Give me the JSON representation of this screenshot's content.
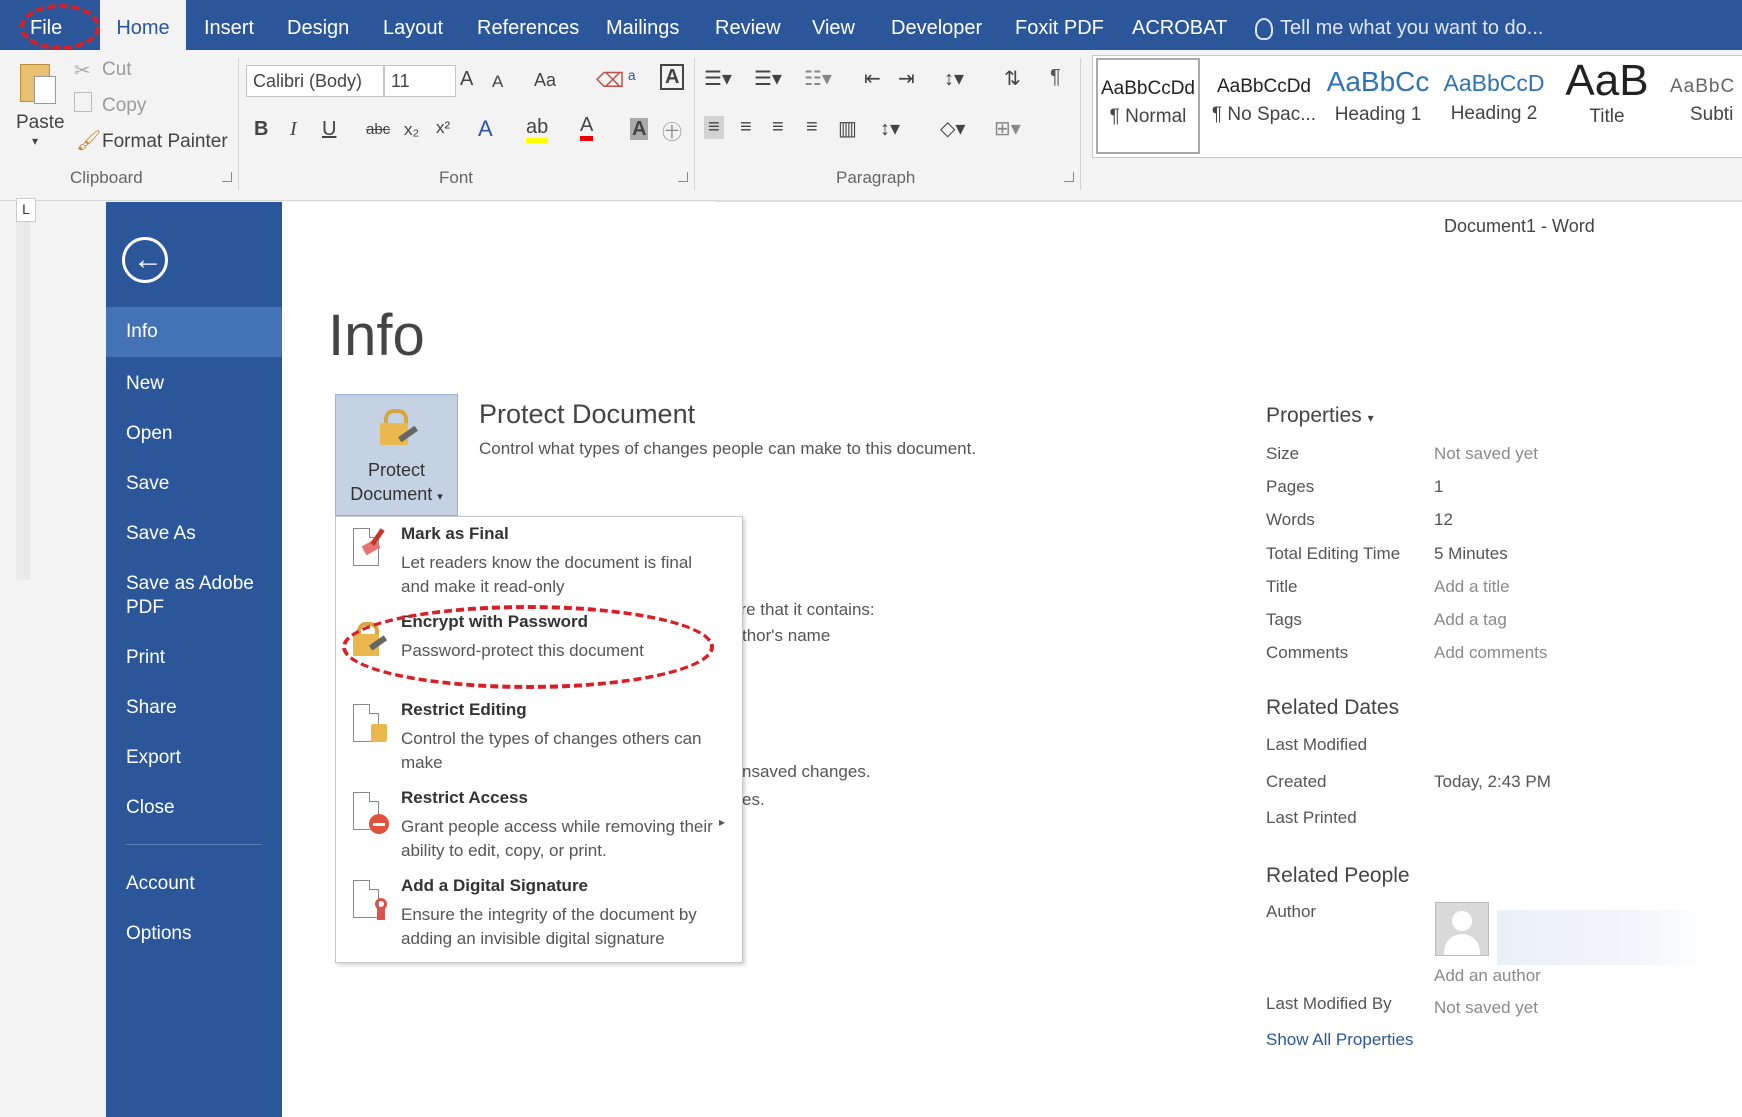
{
  "colors": {
    "accent": "#2b579a",
    "nav_active": "#4472b7",
    "annotation_red": "#d81f26"
  },
  "ribbon": {
    "tabs": [
      "File",
      "Home",
      "Insert",
      "Design",
      "Layout",
      "References",
      "Mailings",
      "Review",
      "View",
      "Developer",
      "Foxit PDF",
      "ACROBAT"
    ],
    "active_tab": "Home",
    "tell_me": "Tell me what you want to do...",
    "clipboard": {
      "paste": "Paste",
      "cut": "Cut",
      "copy": "Copy",
      "format_painter": "Format Painter",
      "group_label": "Clipboard"
    },
    "font": {
      "font_name": "Calibri (Body)",
      "font_size": "11",
      "grow": "A",
      "shrink": "A",
      "change_case": "Aa",
      "bold": "B",
      "italic": "I",
      "underline": "U",
      "strike": "abc",
      "subscript": "x₂",
      "superscript": "x²",
      "group_label": "Font"
    },
    "paragraph": {
      "group_label": "Paragraph",
      "pilcrow": "¶"
    },
    "styles": [
      {
        "sample": "AaBbCcDd",
        "name": "¶ Normal"
      },
      {
        "sample": "AaBbCcDd",
        "name": "¶ No Spac..."
      },
      {
        "sample": "AaBbCc",
        "name": "Heading 1"
      },
      {
        "sample": "AaBbCcD",
        "name": "Heading 2"
      },
      {
        "sample": "AaB",
        "name": "Title"
      },
      {
        "sample": "AaBbC",
        "name": "Subti"
      }
    ]
  },
  "backstage": {
    "nav": {
      "back_icon": "back-arrow-icon",
      "items": [
        "Info",
        "New",
        "Open",
        "Save",
        "Save As",
        "Save as Adobe PDF",
        "Print",
        "Share",
        "Export",
        "Close",
        "Account",
        "Options"
      ],
      "active": "Info"
    },
    "document_title": "Document1 - Word",
    "page_title": "Info",
    "protect": {
      "button_label": "Protect Document",
      "title": "Protect Document",
      "description": "Control what types of changes people can make to this document."
    },
    "behind_text": [
      "are that it contains:",
      "thor's name",
      "nsaved changes.",
      "es."
    ],
    "menu": [
      {
        "title": "Mark as Final",
        "description": "Let readers know the document is final and make it read-only",
        "icon": "mark-final-icon"
      },
      {
        "title": "Encrypt with Password",
        "description": "Password-protect this document",
        "icon": "lock-key-icon"
      },
      {
        "title": "Restrict Editing",
        "description": "Control the types of changes others can make",
        "icon": "document-lock-icon"
      },
      {
        "title": "Restrict Access",
        "description": "Grant people access while removing their ability to edit, copy, or print.",
        "icon": "document-block-icon"
      },
      {
        "title": "Add a Digital Signature",
        "description": "Ensure the integrity of the document by adding an invisible digital signature",
        "icon": "document-ribbon-icon"
      }
    ],
    "properties": {
      "heading": "Properties",
      "rows": [
        {
          "key": "Size",
          "value": "Not saved yet"
        },
        {
          "key": "Pages",
          "value": "1"
        },
        {
          "key": "Words",
          "value": "12"
        },
        {
          "key": "Total Editing Time",
          "value": "5 Minutes"
        },
        {
          "key": "Title",
          "value": "Add a title"
        },
        {
          "key": "Tags",
          "value": "Add a tag"
        },
        {
          "key": "Comments",
          "value": "Add comments"
        }
      ]
    },
    "related_dates": {
      "heading": "Related Dates",
      "last_modified": "Last Modified",
      "created": "Created",
      "created_value": "Today, 2:43 PM",
      "last_printed": "Last Printed"
    },
    "related_people": {
      "heading": "Related People",
      "author": "Author",
      "add_author": "Add an author",
      "last_modified_by": "Last Modified By",
      "last_modified_by_value": "Not saved yet"
    },
    "show_all": "Show All Properties"
  }
}
